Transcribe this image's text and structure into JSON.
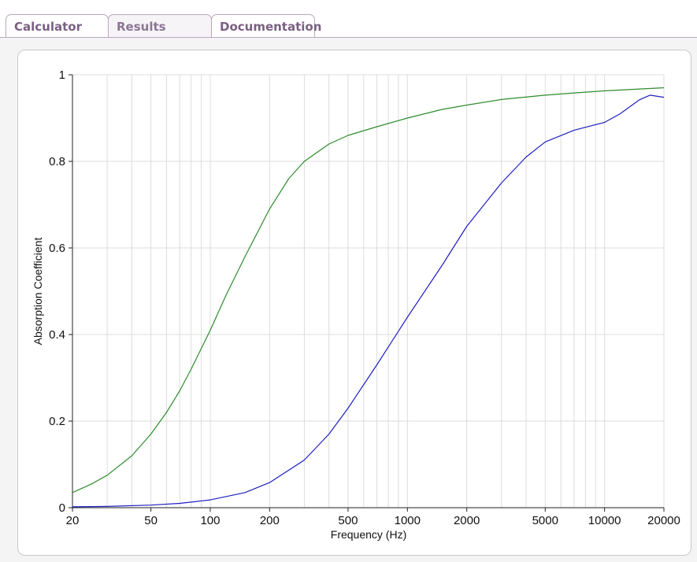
{
  "tabs": [
    {
      "label": "Calculator",
      "active": false
    },
    {
      "label": "Results",
      "active": true
    },
    {
      "label": "Documentation",
      "active": false
    }
  ],
  "chart_data": {
    "type": "line",
    "title": "",
    "xlabel": "Frequency (Hz)",
    "ylabel": "Absorption Coefficient",
    "xscale": "log",
    "xlim": [
      20,
      20000
    ],
    "ylim": [
      0,
      1
    ],
    "grid": true,
    "x_ticks": [
      20,
      50,
      100,
      200,
      500,
      1000,
      2000,
      5000,
      10000,
      20000
    ],
    "y_ticks": [
      0,
      0.2,
      0.4,
      0.6,
      0.8,
      1
    ],
    "y_tick_labels": [
      "0",
      "0.2",
      "0.4",
      "0.6",
      "0.8",
      "1"
    ],
    "series": [
      {
        "color": "#2e8b2e",
        "x": [
          20,
          25,
          30,
          40,
          50,
          60,
          70,
          80,
          100,
          120,
          150,
          200,
          250,
          300,
          400,
          500,
          700,
          1000,
          1500,
          2000,
          3000,
          5000,
          7000,
          10000,
          15000,
          20000
        ],
        "y": [
          0.035,
          0.055,
          0.075,
          0.12,
          0.17,
          0.22,
          0.27,
          0.32,
          0.41,
          0.49,
          0.58,
          0.69,
          0.76,
          0.8,
          0.84,
          0.86,
          0.88,
          0.9,
          0.92,
          0.93,
          0.943,
          0.953,
          0.958,
          0.963,
          0.967,
          0.97
        ]
      },
      {
        "color": "#1f1fbf",
        "x": [
          20,
          30,
          50,
          70,
          100,
          150,
          200,
          300,
          400,
          500,
          700,
          1000,
          1500,
          2000,
          3000,
          4000,
          5000,
          7000,
          10000,
          12000,
          15000,
          17000,
          20000
        ],
        "y": [
          0.002,
          0.003,
          0.006,
          0.01,
          0.018,
          0.035,
          0.058,
          0.11,
          0.17,
          0.23,
          0.33,
          0.44,
          0.56,
          0.65,
          0.75,
          0.81,
          0.845,
          0.872,
          0.89,
          0.91,
          0.942,
          0.953,
          0.948
        ]
      }
    ]
  }
}
